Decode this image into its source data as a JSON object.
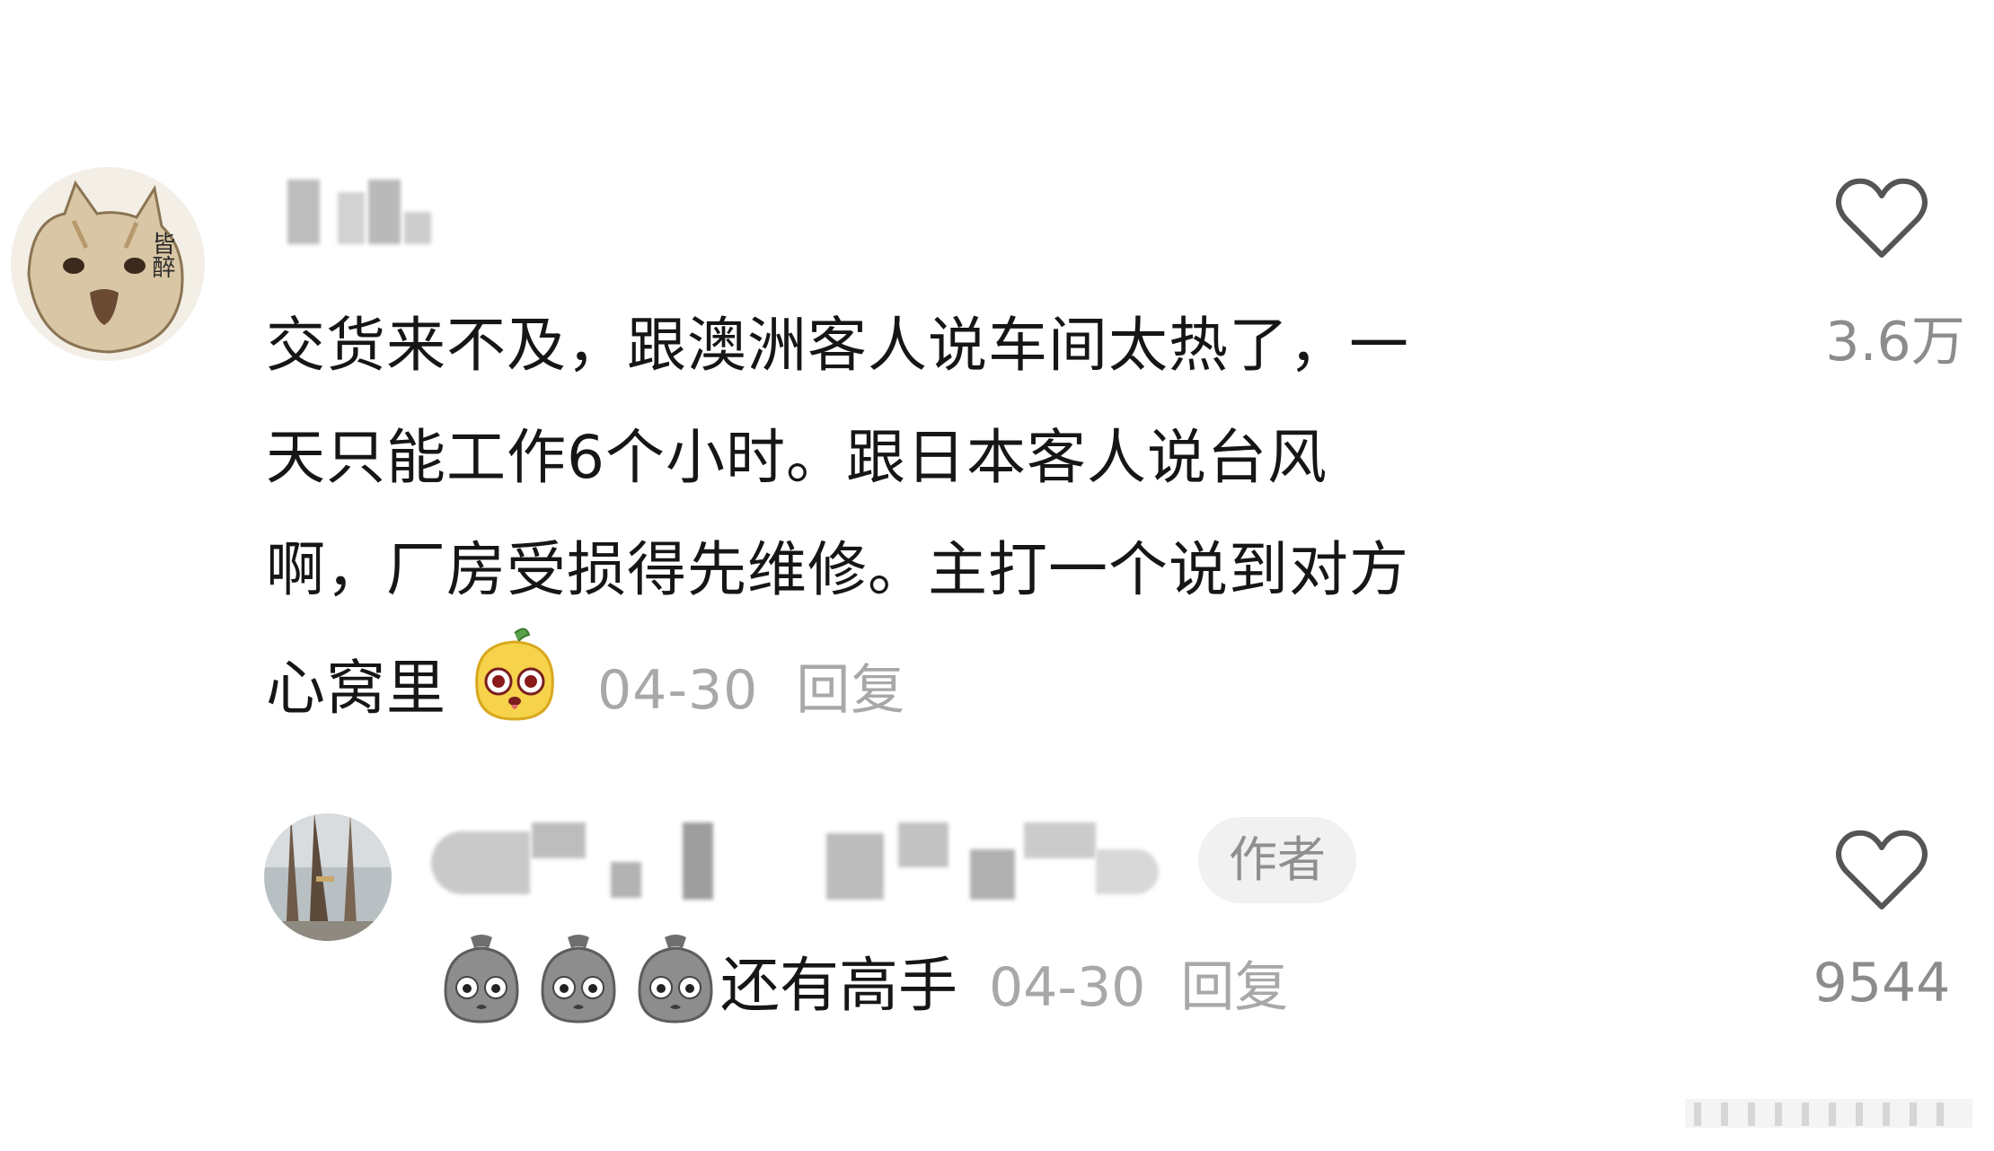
{
  "comment": {
    "text_lines": [
      "交货来不及，跟澳洲客人说车间太热了，一",
      "天只能工作6个小时。跟日本客人说台风",
      "啊，厂房受损得先维修。主打一个说到对方",
      "心窝里"
    ],
    "avatar_sign_text": "皆醉",
    "date": "04-30",
    "reply_label": "回复",
    "like_count": "3.6万",
    "heart_icon": "heart-outline-icon",
    "emoji_icon": "yellow-face-emoji-icon"
  },
  "reply": {
    "author_badge": "作者",
    "text": "还有高手",
    "date": "04-30",
    "reply_label": "回复",
    "like_count": "9544",
    "heart_icon": "heart-outline-icon",
    "emoji_icon": "gray-sack-face-emoji-icon"
  },
  "colors": {
    "text": "#161616",
    "meta": "#a8a8a8",
    "like_count": "#8c8c8c",
    "badge_bg": "#f1f1f1"
  }
}
